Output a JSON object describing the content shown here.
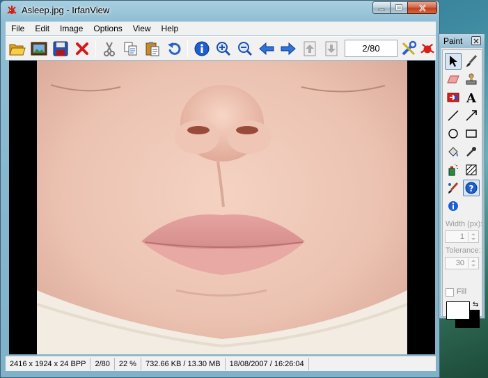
{
  "window": {
    "title": "Asleep.jpg - IrfanView"
  },
  "menu": [
    "File",
    "Edit",
    "Image",
    "Options",
    "View",
    "Help"
  ],
  "toolbar": {
    "page_counter": "2/80"
  },
  "status": {
    "dimensions": "2416 x 1924 x 24 BPP",
    "page": "2/80",
    "zoom": "22 %",
    "size": "732.66 KB / 13.30 MB",
    "datetime": "18/08/2007 / 16:26:04"
  },
  "paint": {
    "title": "Paint",
    "width_label": "Width (px):",
    "width_value": "1",
    "tolerance_label": "Tolerance:",
    "tolerance_value": "30",
    "fill_label": "Fill",
    "fg_color": "#ffffff",
    "bg_color": "#000000"
  },
  "colors": {
    "accent": "#2a73c8",
    "close_red": "#c0401f",
    "title_bar": "#8fbdd3"
  }
}
